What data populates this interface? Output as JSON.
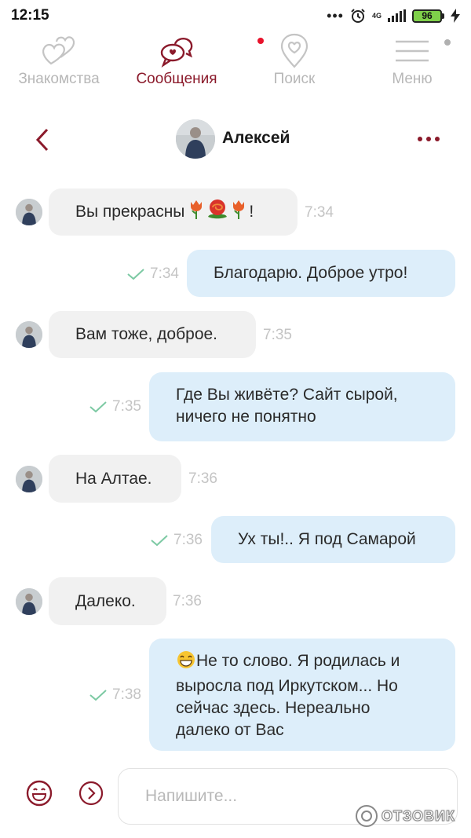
{
  "status_bar": {
    "time": "12:15",
    "network": "4G",
    "battery": "96",
    "battery_color": "#7fd04a"
  },
  "nav": {
    "accent_color": "#8b1a2b",
    "items": [
      {
        "label": "Знакомства",
        "icon": "hearts-icon",
        "active": false
      },
      {
        "label": "Сообщения",
        "icon": "chat-bubbles-icon",
        "active": true,
        "badge_color": "#e8122b"
      },
      {
        "label": "Поиск",
        "icon": "location-heart-icon",
        "active": false
      },
      {
        "label": "Меню",
        "icon": "hamburger-menu-icon",
        "active": false,
        "badge_color": "#b0b0b0"
      }
    ]
  },
  "chat": {
    "contact_name": "Алексей",
    "messages": [
      {
        "direction": "in",
        "text": "Вы прекрасны",
        "emoji": [
          "tulip-icon",
          "rose-icon",
          "tulip-icon"
        ],
        "suffix": "!",
        "time": "7:34"
      },
      {
        "direction": "out",
        "text": "Благодарю. Доброе утро!",
        "time": "7:34",
        "read": true
      },
      {
        "direction": "in",
        "text": "Вам тоже, доброе.",
        "time": "7:35"
      },
      {
        "direction": "out",
        "lines": [
          "Где Вы живёте? Сайт сырой,",
          "ничего не понятно"
        ],
        "time": "7:35",
        "read": true
      },
      {
        "direction": "in",
        "text": "На Алтае.",
        "time": "7:36"
      },
      {
        "direction": "out",
        "text": "Ух ты!.. Я под Самарой",
        "time": "7:36",
        "read": true
      },
      {
        "direction": "in",
        "text": "Далеко.",
        "time": "7:36"
      },
      {
        "direction": "out",
        "emoji": "grinning-face-icon",
        "lines": [
          "Не то слово. Я родилась и",
          "выросла под Иркутском... Но",
          "сейчас здесь. Нереально",
          "далеко от Вас"
        ],
        "time": "7:38",
        "read": true
      }
    ]
  },
  "composer": {
    "placeholder": "Напишите..."
  },
  "watermark": {
    "text": "ОТЗОВИК"
  },
  "colors": {
    "incoming_bubble": "#f1f1f1",
    "outgoing_bubble": "#ddeefa",
    "check_color": "#7cc9a3"
  }
}
